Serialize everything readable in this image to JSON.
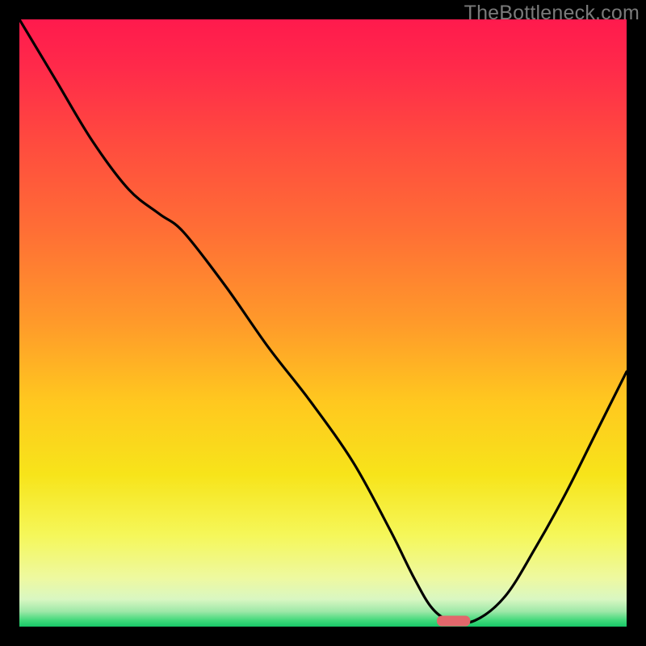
{
  "watermark": "TheBottleneck.com",
  "colors": {
    "gradient_stops": [
      {
        "offset": 0.0,
        "color": "#ff1a4d"
      },
      {
        "offset": 0.08,
        "color": "#ff2a4a"
      },
      {
        "offset": 0.2,
        "color": "#ff4a3f"
      },
      {
        "offset": 0.35,
        "color": "#ff6f35"
      },
      {
        "offset": 0.5,
        "color": "#ff9a2a"
      },
      {
        "offset": 0.63,
        "color": "#ffc81f"
      },
      {
        "offset": 0.75,
        "color": "#f7e41a"
      },
      {
        "offset": 0.85,
        "color": "#f5f75a"
      },
      {
        "offset": 0.92,
        "color": "#eef9a0"
      },
      {
        "offset": 0.955,
        "color": "#d9f7c2"
      },
      {
        "offset": 0.975,
        "color": "#9ee8a8"
      },
      {
        "offset": 0.99,
        "color": "#3fd87a"
      },
      {
        "offset": 1.0,
        "color": "#18c767"
      }
    ],
    "curve": "#000000",
    "marker": "#e2676b",
    "frame": "#000000"
  },
  "chart_data": {
    "type": "line",
    "x": [
      0.0,
      0.06,
      0.12,
      0.18,
      0.23,
      0.27,
      0.34,
      0.41,
      0.48,
      0.55,
      0.61,
      0.65,
      0.68,
      0.71,
      0.75,
      0.8,
      0.85,
      0.9,
      0.95,
      1.0
    ],
    "y": [
      1.0,
      0.9,
      0.8,
      0.72,
      0.68,
      0.65,
      0.56,
      0.46,
      0.37,
      0.27,
      0.16,
      0.08,
      0.03,
      0.01,
      0.01,
      0.05,
      0.13,
      0.22,
      0.32,
      0.42
    ],
    "xlim": [
      0,
      1
    ],
    "ylim": [
      0,
      1
    ],
    "title": "",
    "xlabel": "",
    "ylabel": "",
    "marker": {
      "x": 0.715,
      "y": 0.01,
      "width_frac": 0.055
    }
  }
}
